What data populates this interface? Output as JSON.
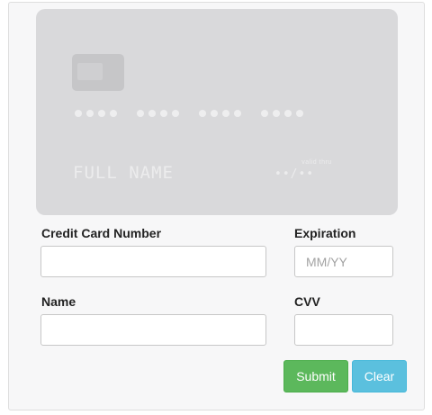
{
  "card_preview": {
    "number_placeholder": [
      "••••",
      "••••",
      "••••",
      "••••"
    ],
    "name_placeholder": "FULL NAME",
    "valid_thru_label": "valid thru",
    "expiry_placeholder": "••/••"
  },
  "form": {
    "card_number": {
      "label": "Credit Card Number",
      "value": "",
      "placeholder": ""
    },
    "expiration": {
      "label": "Expiration",
      "value": "",
      "placeholder": "MM/YY"
    },
    "name": {
      "label": "Name",
      "value": "",
      "placeholder": ""
    },
    "cvv": {
      "label": "CVV",
      "value": "",
      "placeholder": ""
    }
  },
  "buttons": {
    "submit_label": "Submit",
    "clear_label": "Clear"
  },
  "colors": {
    "submit": "#5cb85c",
    "clear": "#5bc0de",
    "card_background": "#d9d9db"
  }
}
